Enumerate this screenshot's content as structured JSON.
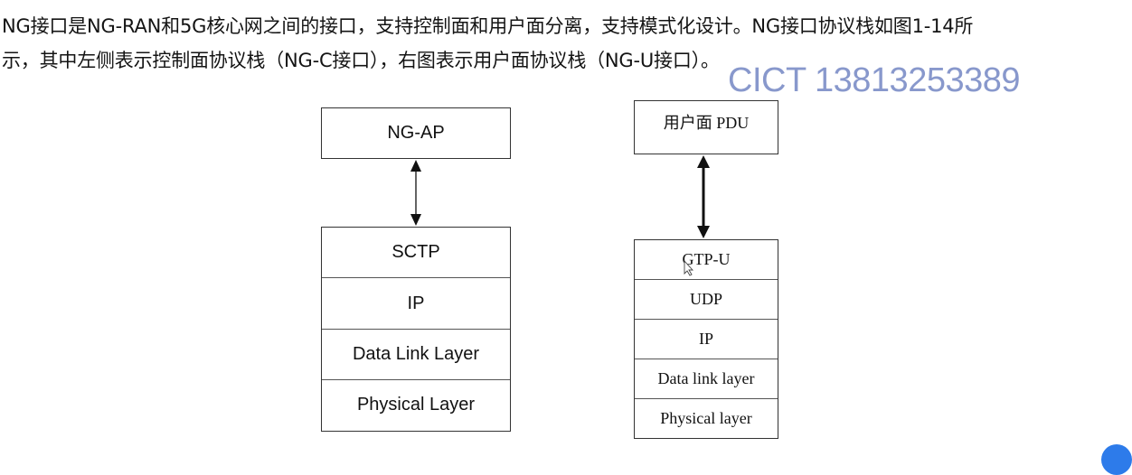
{
  "text": {
    "line1": "NG接口是NG-RAN和5G核心网之间的接口，支持控制面和用户面分离，支持模式化设计。NG接口协议栈如图1-14所",
    "line2": "示，其中左侧表示控制面协议栈（NG-C接口），右图表示用户面协议栈（NG-U接口）。"
  },
  "watermark": "CICT 13813253389",
  "left_stack": {
    "top": "NG-AP",
    "layers": [
      "SCTP",
      "IP",
      "Data Link Layer",
      "Physical Layer"
    ]
  },
  "right_stack": {
    "top": "用户面 PDU",
    "layers": [
      "GTP-U",
      "UDP",
      "IP",
      "Data link layer",
      "Physical layer"
    ]
  },
  "colors": {
    "watermark": "#6b7fc0",
    "border": "#333333"
  }
}
